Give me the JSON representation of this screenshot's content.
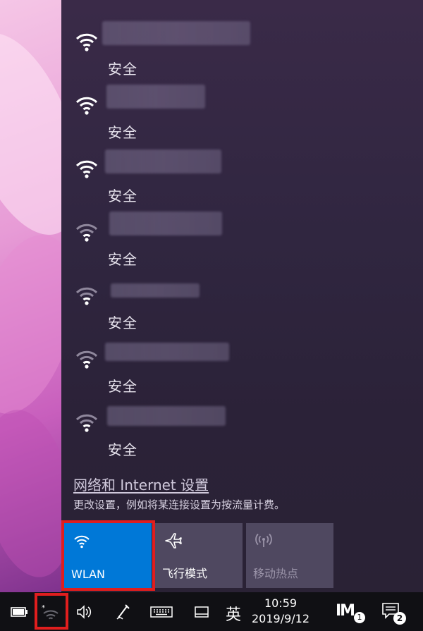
{
  "networks": [
    {
      "status": "安全",
      "signal": "strong"
    },
    {
      "status": "安全",
      "signal": "strong"
    },
    {
      "status": "安全",
      "signal": "strong"
    },
    {
      "status": "安全",
      "signal": "weak"
    },
    {
      "status": "安全",
      "signal": "weak"
    },
    {
      "status": "安全",
      "signal": "weak"
    },
    {
      "status": "安全",
      "signal": "weak"
    }
  ],
  "settings": {
    "link_label": "网络和 Internet 设置",
    "description": "更改设置，例如将某连接设置为按流量计费。"
  },
  "quick_actions": [
    {
      "label": "WLAN",
      "state": "on",
      "icon": "wifi-icon"
    },
    {
      "label": "飞行模式",
      "state": "off",
      "icon": "airplane-icon"
    },
    {
      "label": "移动热点",
      "state": "disabled",
      "icon": "hotspot-icon"
    }
  ],
  "taskbar": {
    "input_language": "英",
    "time": "10:59",
    "date": "2019/9/12",
    "app_badge": "1",
    "notification_count": "2"
  },
  "colors": {
    "accent": "#0078d7",
    "highlight": "#e01e1e",
    "flyout_bg": "#2b2238"
  }
}
